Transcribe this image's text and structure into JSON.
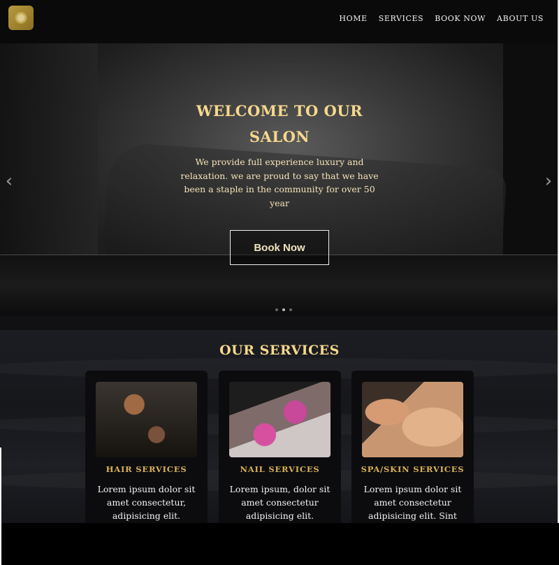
{
  "nav": {
    "items": [
      "HOME",
      "SERVICES",
      "BOOK NOW",
      "ABOUT US"
    ]
  },
  "hero": {
    "title": "WELCOME TO OUR SALON",
    "text": "We provide full experience luxury and relaxation. we are proud to say that we have been a staple in the community for over 50 year",
    "button": "Book Now",
    "prev_icon": "chevron-left-icon",
    "next_icon": "chevron-right-icon"
  },
  "services": {
    "title": "OUR SERVICES",
    "cards": [
      {
        "title": "HAIR SERVICES",
        "text": "Lorem ipsum dolor sit amet consectetur, adipisicing elit."
      },
      {
        "title": "NAIL SERVICES",
        "text": "Lorem ipsum, dolor sit amet consectetur adipisicing elit."
      },
      {
        "title": "SPA/SKIN SERVICES",
        "text": "Lorem ipsum dolor sit amet consectetur adipisicing elit. Sint"
      }
    ]
  },
  "colors": {
    "accent_gold": "#f6d88e",
    "card_title_gold": "#d9b255",
    "nav_bg": "#0a0a0b"
  }
}
